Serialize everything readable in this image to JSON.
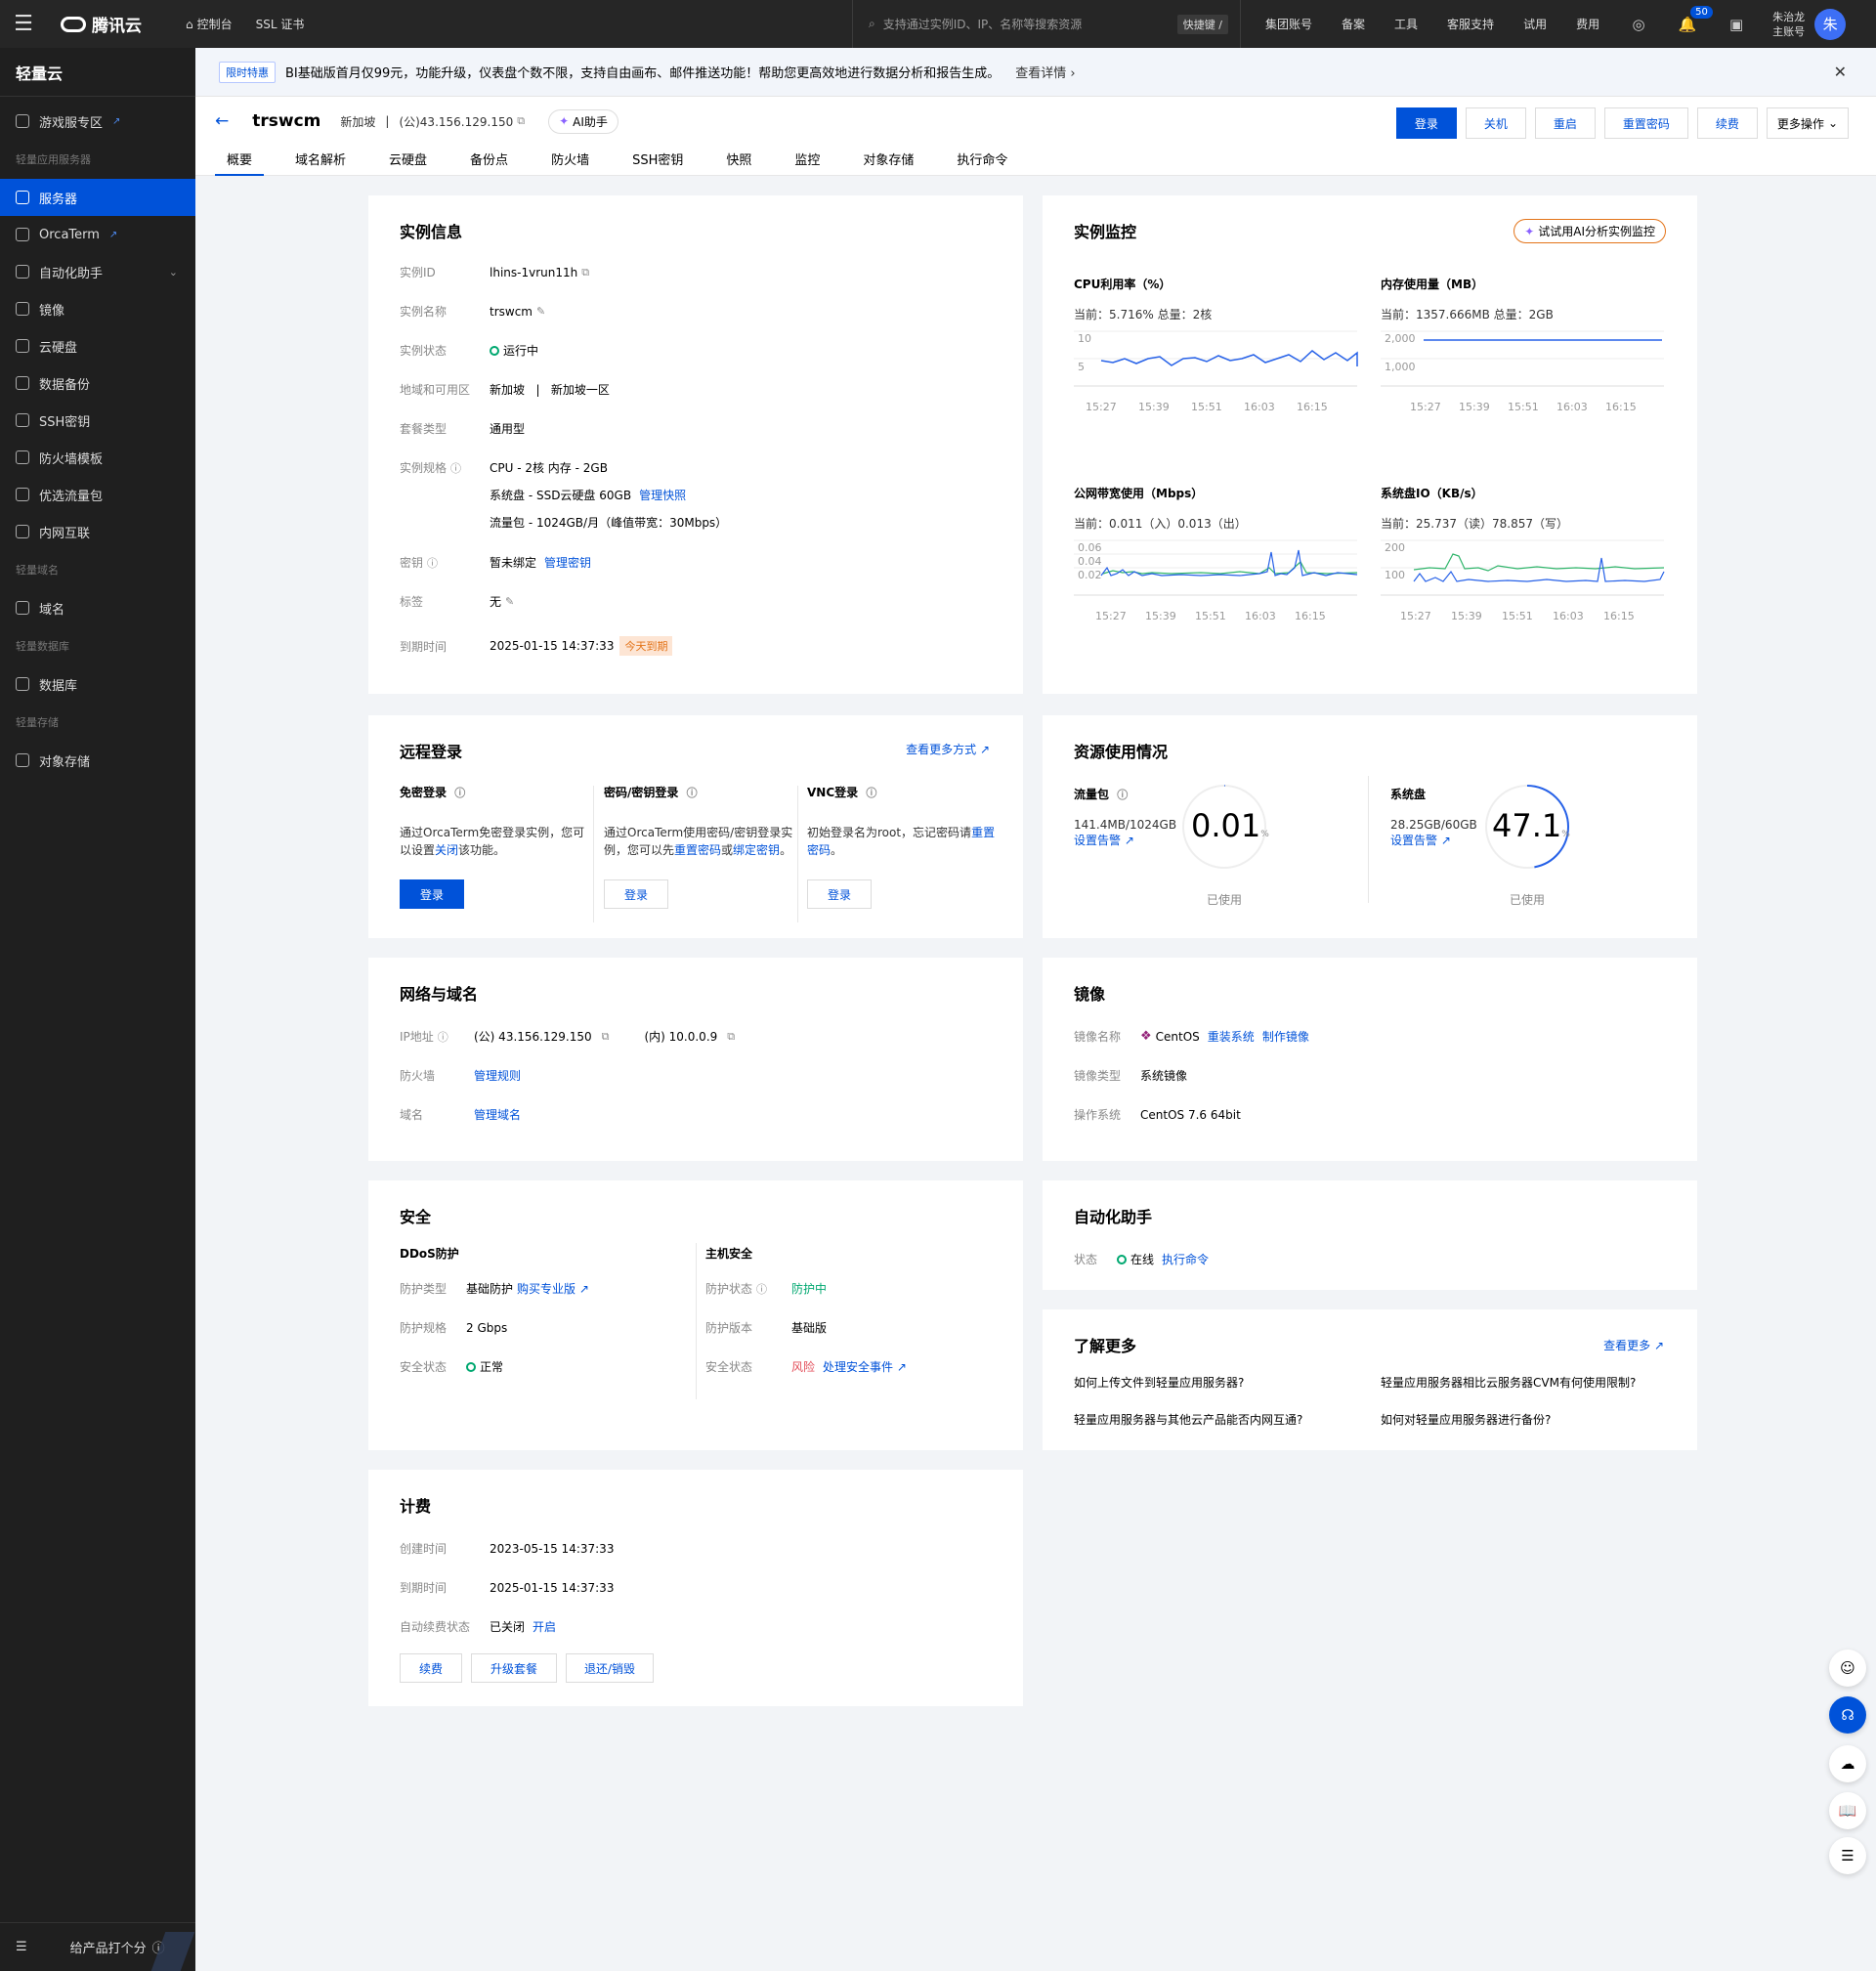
{
  "topbar": {
    "brand": "腾讯云",
    "console": "控制台",
    "ssl": "SSL 证书",
    "search_placeholder": "支持通过实例ID、IP、名称等搜索资源",
    "shortcut": "快捷键 /",
    "links": [
      "集团账号",
      "备案",
      "工具",
      "客服支持",
      "试用",
      "费用"
    ],
    "notify_count": "50",
    "user_name": "朱治龙",
    "user_role": "主账号",
    "avatar_text": "朱"
  },
  "sidebar": {
    "title": "轻量云",
    "items": [
      {
        "label": "游戏服专区",
        "ext": "true"
      },
      {
        "group": "轻量应用服务器"
      },
      {
        "label": "服务器",
        "active": "true"
      },
      {
        "label": "OrcaTerm",
        "ext": "true"
      },
      {
        "label": "自动化助手",
        "arrow": "true"
      },
      {
        "label": "镜像"
      },
      {
        "label": "云硬盘"
      },
      {
        "label": "数据备份"
      },
      {
        "label": "SSH密钥"
      },
      {
        "label": "防火墙模板"
      },
      {
        "label": "优选流量包"
      },
      {
        "label": "内网互联"
      },
      {
        "group": "轻量域名"
      },
      {
        "label": "域名"
      },
      {
        "group": "轻量数据库"
      },
      {
        "label": "数据库"
      },
      {
        "group": "轻量存储"
      },
      {
        "label": "对象存储"
      }
    ],
    "footer": "给产品打个分"
  },
  "notice": {
    "tag": "限时特惠",
    "text": "BI基础版首月仅99元，功能升级，仪表盘个数不限，支持自由画布、邮件推送功能！帮助您更高效地进行数据分析和报告生成。",
    "more": "查看详情 ›"
  },
  "header": {
    "name": "trswcm",
    "region": "新加坡",
    "sep": "|",
    "ip": "(公)43.156.129.150",
    "ai": "AI助手",
    "actions": [
      "登录",
      "关机",
      "重启",
      "重置密码",
      "续费"
    ],
    "more": "更多操作",
    "tabs": [
      "概要",
      "域名解析",
      "云硬盘",
      "备份点",
      "防火墙",
      "SSH密钥",
      "快照",
      "监控",
      "对象存储",
      "执行命令"
    ]
  },
  "instance": {
    "title": "实例信息",
    "id_label": "实例ID",
    "id": "lhins-1vrun11h",
    "name_label": "实例名称",
    "name": "trswcm",
    "status_label": "实例状态",
    "status": "运行中",
    "zone_label": "地域和可用区",
    "zone": "新加坡   |   新加坡一区",
    "plan_label": "套餐类型",
    "plan": "通用型",
    "spec_label": "实例规格",
    "spec_cpu": "CPU - 2核 内存 - 2GB",
    "spec_disk": "系统盘 - SSD云硬盘 60GB",
    "spec_disk_link": "管理快照",
    "spec_traffic": "流量包 - 1024GB/月（峰值带宽：30Mbps）",
    "key_label": "密钥",
    "key": "暂未绑定",
    "key_link": "管理密钥",
    "tag_label": "标签",
    "tag": "无",
    "expire_label": "到期时间",
    "expire": "2025-01-15 14:37:33",
    "expire_badge": "今天到期"
  },
  "monitor": {
    "title": "实例监控",
    "ai": "试试用AI分析实例监控",
    "charts": [
      {
        "title": "CPU利用率（%）",
        "sub": "当前：5.716% 总量：2核",
        "y_ticks": [
          "10",
          "5"
        ],
        "x_ticks": [
          "15:27",
          "15:39",
          "15:51",
          "16:03",
          "16:15"
        ]
      },
      {
        "title": "内存使用量（MB）",
        "sub": "当前：1357.666MB 总量：2GB",
        "y_ticks": [
          "2,000",
          "1,000"
        ],
        "x_ticks": [
          "15:27",
          "15:39",
          "15:51",
          "16:03",
          "16:15"
        ]
      },
      {
        "title": "公网带宽使用（Mbps）",
        "sub": "当前：0.011（入）0.013（出）",
        "y_ticks": [
          "0.06",
          "0.04",
          "0.02"
        ],
        "x_ticks": [
          "15:27",
          "15:39",
          "15:51",
          "16:03",
          "16:15"
        ]
      },
      {
        "title": "系统盘IO（KB/s）",
        "sub": "当前：25.737（读）78.857（写）",
        "y_ticks": [
          "200",
          "100"
        ],
        "x_ticks": [
          "15:27",
          "15:39",
          "15:51",
          "16:03",
          "16:15"
        ]
      }
    ]
  },
  "remote": {
    "title": "远程登录",
    "more": "查看更多方式",
    "cols": [
      {
        "h": "免密登录",
        "d1": "通过OrcaTerm免密登录实例，您可以设置",
        "link1": "关闭",
        "d2": "该功能。",
        "btn": "登录"
      },
      {
        "h": "密码/密钥登录",
        "d1": "通过OrcaTerm使用密码/密钥登录实例，您可以先",
        "link1": "重置密码",
        "mid": "或",
        "link2": "绑定密钥",
        "d2": "。",
        "btn": "登录"
      },
      {
        "h": "VNC登录",
        "d1": "初始登录名为root，忘记密码请",
        "link1": "重置密码",
        "d2": "。",
        "btn": "登录"
      }
    ]
  },
  "resource": {
    "title": "资源使用情况",
    "traffic": {
      "label": "流量包",
      "val": "141.4MB/1024GB",
      "set": "设置告警",
      "num": "0.01",
      "unit": "%",
      "used": "已使用",
      "pct": 0.01
    },
    "disk": {
      "label": "系统盘",
      "val": "28.25GB/60GB",
      "set": "设置告警",
      "num": "47.1",
      "unit": "%",
      "used": "已使用",
      "pct": 47.1
    }
  },
  "network": {
    "title": "网络与域名",
    "ip_label": "IP地址",
    "ip_pub": "(公) 43.156.129.150",
    "ip_priv": "(内) 10.0.0.9",
    "fw_label": "防火墙",
    "fw_link": "管理规则",
    "domain_label": "域名",
    "domain_link": "管理域名"
  },
  "image": {
    "title": "镜像",
    "name_label": "镜像名称",
    "name": "CentOS",
    "reinstall": "重装系统",
    "make": "制作镜像",
    "type_label": "镜像类型",
    "type": "系统镜像",
    "os_label": "操作系统",
    "os": "CentOS 7.6 64bit"
  },
  "security": {
    "title": "安全",
    "ddos_title": "DDoS防护",
    "ddos_type_label": "防护类型",
    "ddos_type": "基础防护",
    "ddos_buy": "购买专业版",
    "ddos_spec_label": "防护规格",
    "ddos_spec": "2 Gbps",
    "ddos_state_label": "安全状态",
    "ddos_state": "正常",
    "host_title": "主机安全",
    "host_state_label": "防护状态",
    "host_state": "防护中",
    "host_ver_label": "防护版本",
    "host_ver": "基础版",
    "host_safe_label": "安全状态",
    "host_safe": "风险",
    "host_event": "处理安全事件"
  },
  "automation": {
    "title": "自动化助手",
    "state_label": "状态",
    "state": "在线",
    "run": "执行命令"
  },
  "learn": {
    "title": "了解更多",
    "more": "查看更多",
    "q": [
      "如何上传文件到轻量应用服务器?",
      "轻量应用服务器相比云服务器CVM有何使用限制?",
      "轻量应用服务器与其他云产品能否内网互通?",
      "如何对轻量应用服务器进行备份?"
    ]
  },
  "billing": {
    "title": "计费",
    "created_label": "创建时间",
    "created": "2023-05-15 14:37:33",
    "expire_label": "到期时间",
    "expire": "2025-01-15 14:37:33",
    "renew_label": "自动续费状态",
    "renew": "已关闭",
    "renew_link": "开启",
    "buttons": [
      "续费",
      "升级套餐",
      "退还/销毁"
    ]
  },
  "colors": {
    "brand": "#0052d9",
    "ok": "#00a870",
    "warn": "#e37318",
    "danger": "#e34d59"
  }
}
